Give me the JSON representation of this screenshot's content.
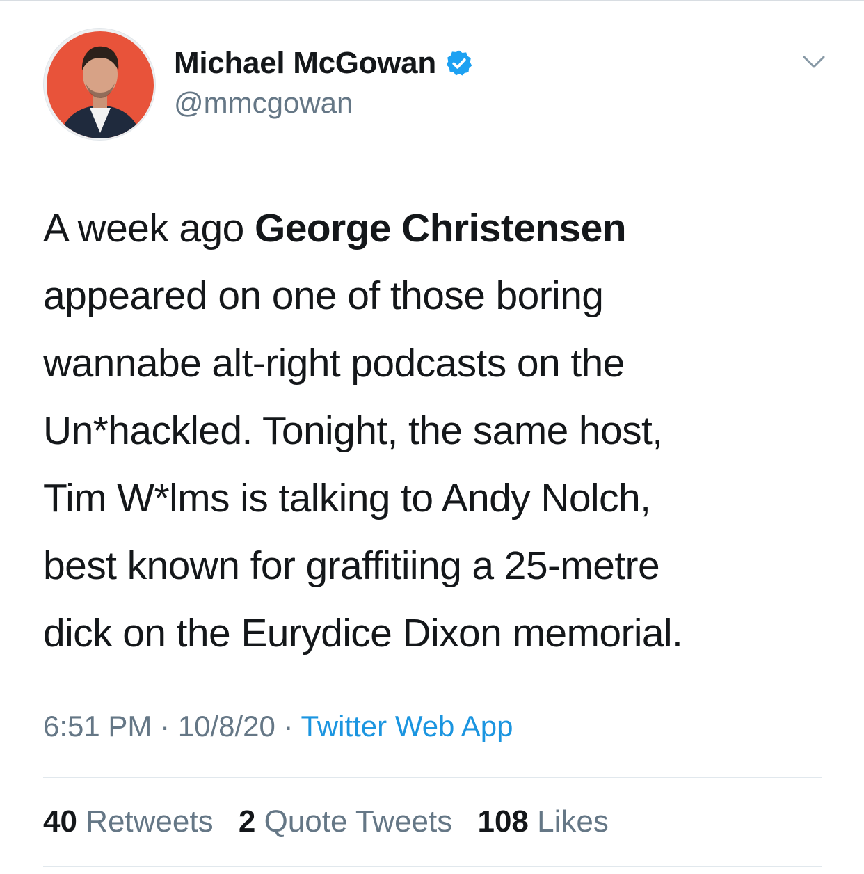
{
  "user": {
    "display_name": "Michael McGowan",
    "handle": "@mmcgowan",
    "verified_icon": "verified-badge-icon",
    "avatar_bg": "#e8533a"
  },
  "tweet": {
    "lines": [
      "A week ago ",
      "appeared on one of those boring",
      "wannabe alt-right podcasts on the",
      "Un*hackled. Tonight, the same host,",
      "Tim W*lms is talking to Andy Nolch,",
      "best known for graffitiing a 25-metre",
      "dick on the Eurydice Dixon memorial."
    ],
    "bold_mention": "George Christensen"
  },
  "meta": {
    "time": "6:51 PM",
    "sep1": " · ",
    "date": "10/8/20",
    "sep2": " · ",
    "source": "Twitter Web App"
  },
  "stats": {
    "retweets_count": "40",
    "retweets_label": "Retweets",
    "quotes_count": "2",
    "quotes_label": "Quote Tweets",
    "likes_count": "108",
    "likes_label": "Likes"
  },
  "colors": {
    "accent": "#1b95e0",
    "secondary_text": "#657786",
    "verified": "#1da1f2"
  },
  "icons": {
    "menu": "chevron-down-icon"
  }
}
